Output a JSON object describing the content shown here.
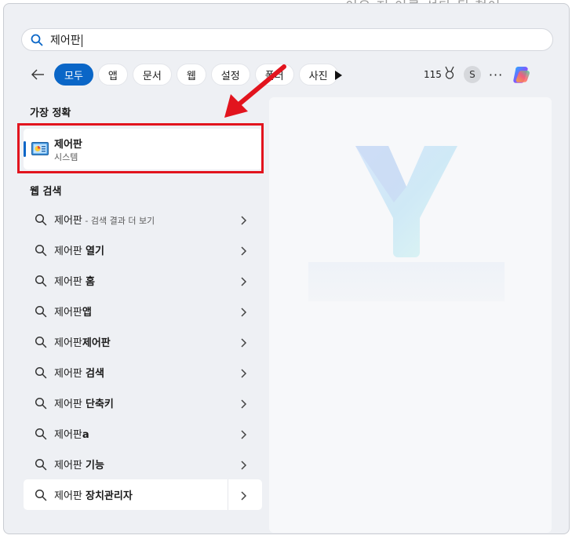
{
  "search": {
    "query": "제어판"
  },
  "filters": [
    "모두",
    "앱",
    "문서",
    "웹",
    "설정",
    "폴더",
    "사진"
  ],
  "header": {
    "points": "115",
    "avatar_initial": "S",
    "more": "···"
  },
  "best_match": {
    "label": "가장 정확",
    "title": "제어판",
    "subtitle": "시스템"
  },
  "web": {
    "label": "웹 검색",
    "items": [
      {
        "prefix": "제어판",
        "suffix": "",
        "hint": " - 검색 결과 더 보기"
      },
      {
        "prefix": "제어판 ",
        "suffix": "열기",
        "hint": ""
      },
      {
        "prefix": "제어판 ",
        "suffix": "홈",
        "hint": ""
      },
      {
        "prefix": "제어판",
        "suffix": "앱",
        "hint": ""
      },
      {
        "prefix": "제어판",
        "suffix": "제어판",
        "hint": ""
      },
      {
        "prefix": "제어판 ",
        "suffix": "검색",
        "hint": ""
      },
      {
        "prefix": "제어판 ",
        "suffix": "단축키",
        "hint": ""
      },
      {
        "prefix": "제어판",
        "suffix": "a",
        "hint": ""
      },
      {
        "prefix": "제어판 ",
        "suffix": "기능",
        "hint": ""
      },
      {
        "prefix": "제어판 ",
        "suffix": "장치관리자",
        "hint": ""
      }
    ]
  },
  "colors": {
    "accent": "#0a66c7",
    "annotation": "#e2141e"
  },
  "icons": {
    "search": "search-icon",
    "back": "arrow-left-icon",
    "play": "play-icon",
    "medal": "medal-icon",
    "copilot": "copilot-icon",
    "control_panel": "control-panel-icon",
    "chevron": "chevron-right-icon"
  }
}
